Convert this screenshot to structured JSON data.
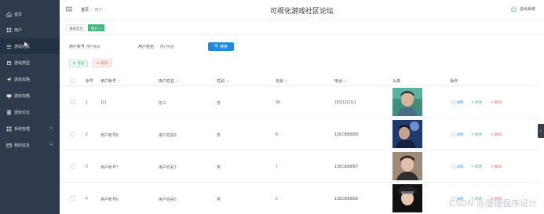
{
  "header": {
    "breadcrumb_home": "首页",
    "breadcrumb_sep": "/",
    "breadcrumb_current": "用户",
    "app_title": "可视化游戏社区论坛",
    "logout_label": "退出系统"
  },
  "sidebar": {
    "items": [
      {
        "label": "首页",
        "icon": "home-icon"
      },
      {
        "label": "用户",
        "icon": "grid-icon"
      },
      {
        "label": "游戏信息",
        "icon": "list-icon"
      },
      {
        "label": "游戏类型",
        "icon": "category-icon"
      },
      {
        "label": "游戏攻略",
        "icon": "send-icon"
      },
      {
        "label": "游戏攻略",
        "icon": "monitor-icon"
      },
      {
        "label": "游戏论坛",
        "icon": "document-icon"
      },
      {
        "label": "系统管理",
        "icon": "apps-icon"
      },
      {
        "label": "我的信息",
        "icon": "file-icon"
      }
    ]
  },
  "tabs": [
    {
      "label": "系统首页"
    },
    {
      "label": "用户 ×"
    }
  ],
  "search": {
    "account_label": "用户账号",
    "account_placeholder": "用户账号",
    "name_label": "用户姓名",
    "name_placeholder": "用户姓名",
    "button_label": "搜索"
  },
  "actions": {
    "add_label": "增加",
    "delete_label": "删除"
  },
  "table": {
    "headers": {
      "index": "序号",
      "account": "用户账号",
      "name": "用户姓名",
      "gender": "性别",
      "age": "年龄",
      "phone": "电话",
      "avatar": "头像",
      "ops": "操作"
    },
    "rows": [
      {
        "index": "1",
        "account": "111",
        "name": "张三",
        "gender": "男",
        "age": "35",
        "phone": "18111111111"
      },
      {
        "index": "2",
        "account": "用户账号8",
        "name": "用户姓名8",
        "gender": "男",
        "age": "8",
        "phone": "13823888888"
      },
      {
        "index": "3",
        "account": "用户账号7",
        "name": "用户姓名7",
        "gender": "男",
        "age": "7",
        "phone": "13823888887"
      },
      {
        "index": "4",
        "account": "用户账号6",
        "name": "用户姓名6",
        "gender": "男",
        "age": "6",
        "phone": "13823888886"
      }
    ],
    "op_detail": "详情",
    "op_edit": "修改",
    "op_delete": "删除"
  },
  "watermark": "CSDN @便捷程序设计",
  "colors": {
    "sidebar_bg": "#2f3a4c",
    "accent_green": "#42b983",
    "accent_blue": "#1e88e5",
    "danger": "#f56c6c"
  }
}
